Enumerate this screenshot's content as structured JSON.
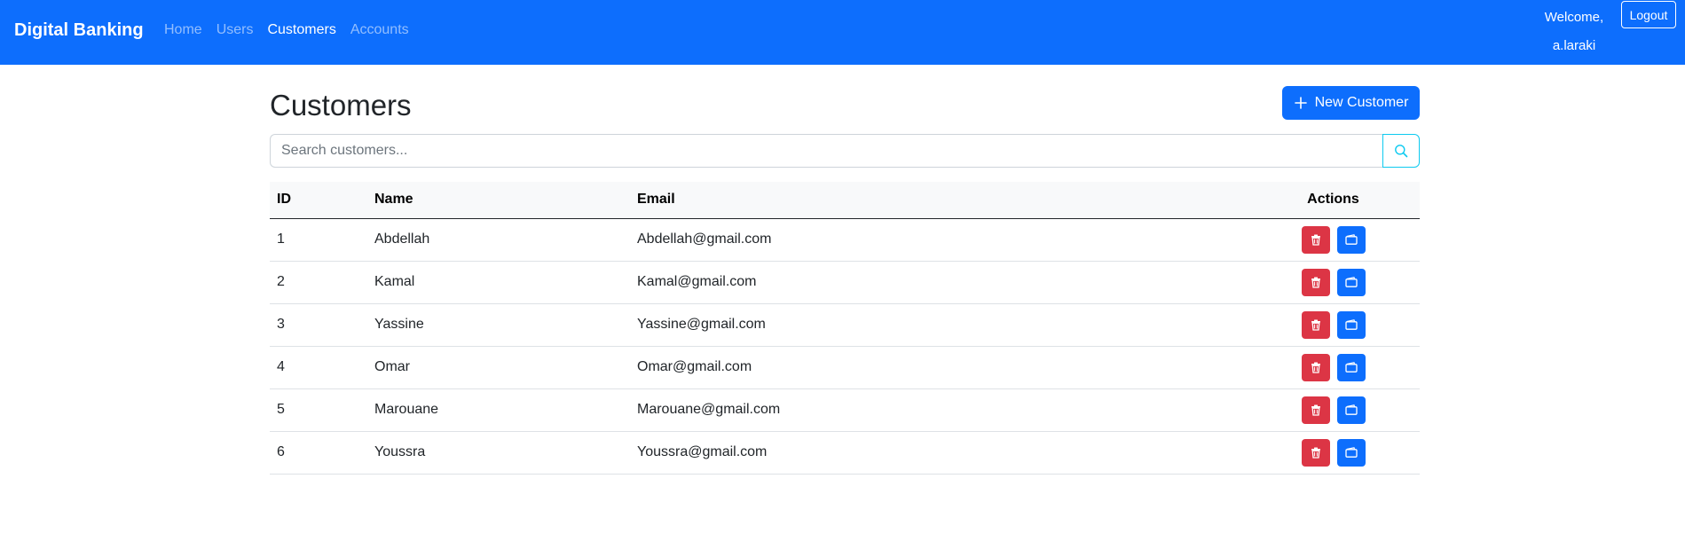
{
  "navbar": {
    "brand": "Digital Banking",
    "links": [
      {
        "label": "Home",
        "active": false
      },
      {
        "label": "Users",
        "active": false
      },
      {
        "label": "Customers",
        "active": true
      },
      {
        "label": "Accounts",
        "active": false
      }
    ],
    "welcome_text": "Welcome, a.laraki",
    "logout_label": "Logout"
  },
  "page": {
    "title": "Customers",
    "new_button_label": "New Customer",
    "search_placeholder": "Search customers...",
    "search_value": ""
  },
  "table": {
    "headers": {
      "id": "ID",
      "name": "Name",
      "email": "Email",
      "actions": "Actions"
    },
    "rows": [
      {
        "id": "1",
        "name": "Abdellah",
        "email": "Abdellah@gmail.com"
      },
      {
        "id": "2",
        "name": "Kamal",
        "email": "Kamal@gmail.com"
      },
      {
        "id": "3",
        "name": "Yassine",
        "email": "Yassine@gmail.com"
      },
      {
        "id": "4",
        "name": "Omar",
        "email": "Omar@gmail.com"
      },
      {
        "id": "5",
        "name": "Marouane",
        "email": "Marouane@gmail.com"
      },
      {
        "id": "6",
        "name": "Youssra",
        "email": "Youssra@gmail.com"
      }
    ],
    "row_actions": [
      {
        "icon": "trash-icon",
        "color": "#dc3545"
      },
      {
        "icon": "wallet-icon",
        "color": "#0d6efd"
      }
    ]
  },
  "colors": {
    "navbar_bg": "#0d6efd",
    "primary": "#0d6efd",
    "danger": "#dc3545",
    "info": "#0dcaf0"
  }
}
